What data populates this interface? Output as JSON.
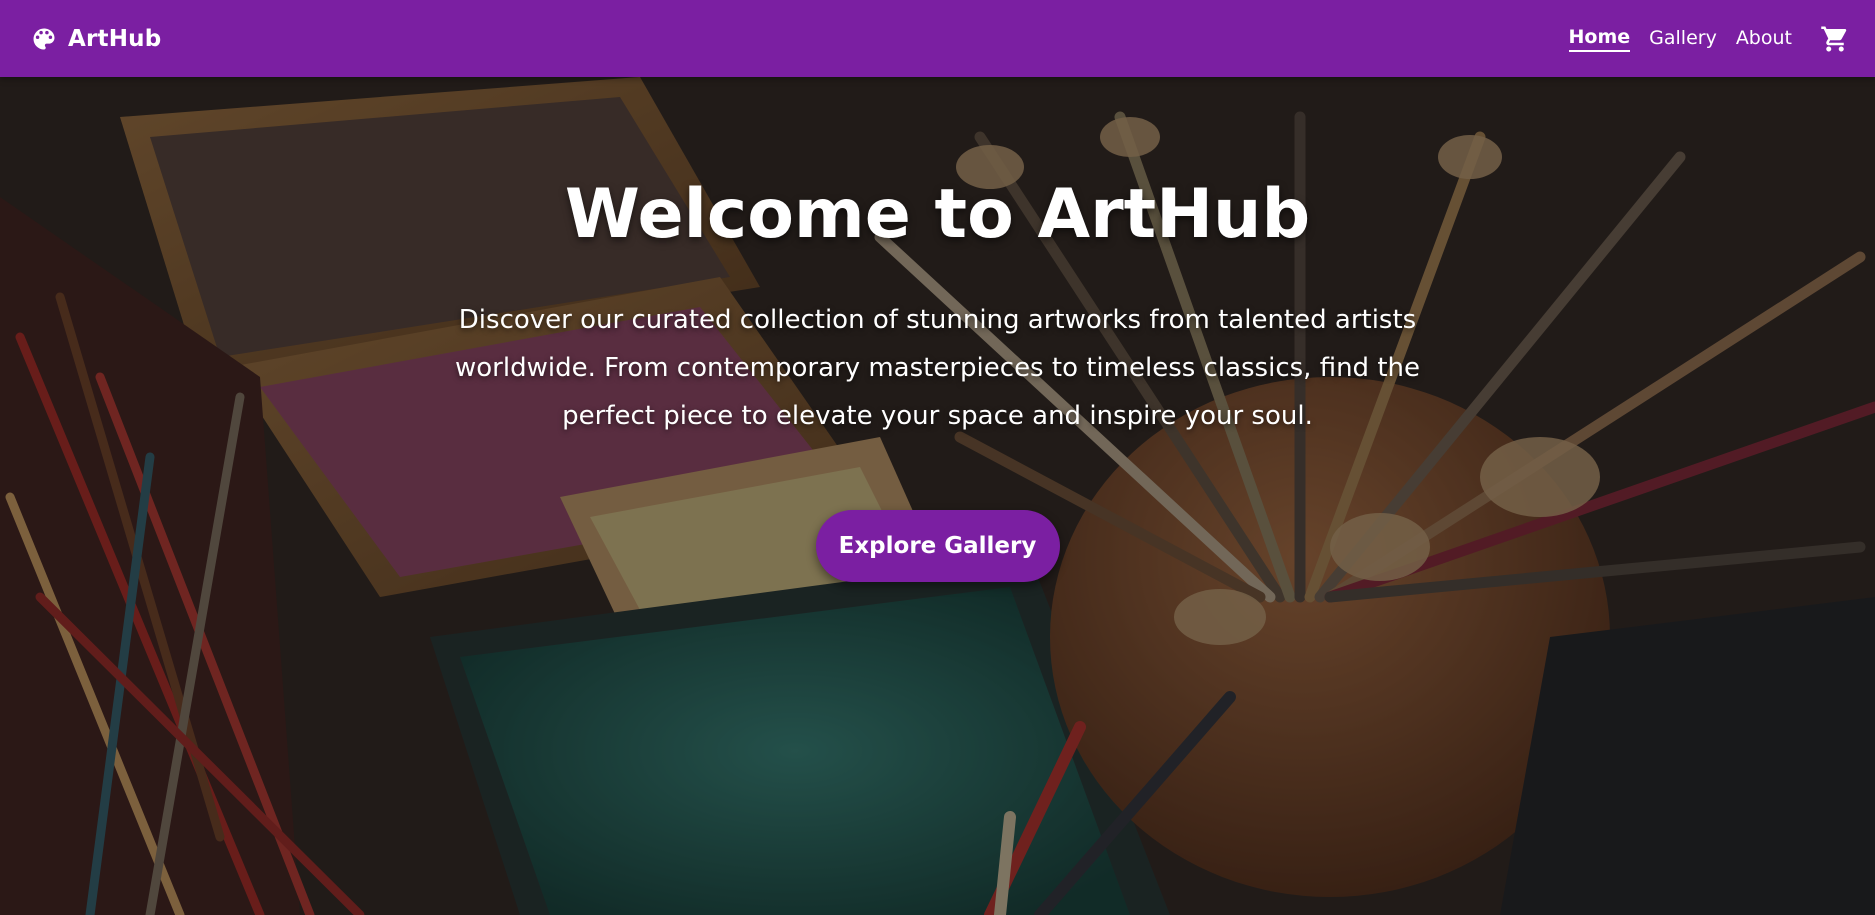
{
  "nav": {
    "brand_name": "ArtHub",
    "brand_icon": "palette-icon",
    "links": [
      {
        "label": "Home",
        "active": true
      },
      {
        "label": "Gallery",
        "active": false
      },
      {
        "label": "About",
        "active": false
      }
    ],
    "cart_icon": "shopping-cart-icon"
  },
  "hero": {
    "title": "Welcome to ArtHub",
    "subtitle": "Discover our curated collection of stunning artworks from talented artists worldwide. From contemporary masterpieces to timeless classics, find the perfect piece to elevate your space and inspire your soul.",
    "cta_label": "Explore Gallery",
    "background": "art-supplies-photo"
  },
  "colors": {
    "primary": "#7b1fa2",
    "text": "#ffffff"
  }
}
